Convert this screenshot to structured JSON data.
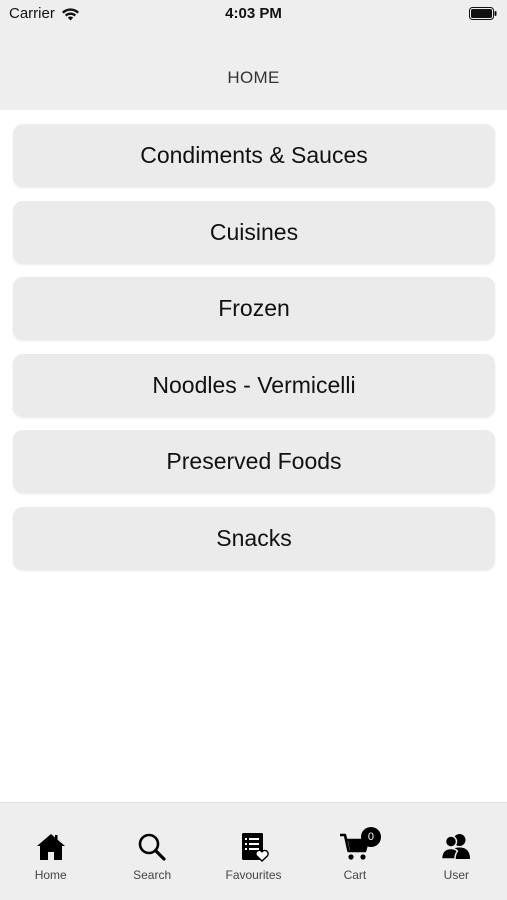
{
  "status_bar": {
    "carrier": "Carrier",
    "time": "4:03 PM",
    "icons": [
      "wifi-icon",
      "battery-icon"
    ]
  },
  "header": {
    "title": "HOME"
  },
  "categories": [
    {
      "label": "Condiments & Sauces"
    },
    {
      "label": "Cuisines"
    },
    {
      "label": "Frozen"
    },
    {
      "label": "Noodles - Vermicelli"
    },
    {
      "label": "Preserved Foods"
    },
    {
      "label": "Snacks"
    }
  ],
  "tab_bar": {
    "items": [
      {
        "label": "Home",
        "icon": "home-icon"
      },
      {
        "label": "Search",
        "icon": "search-icon"
      },
      {
        "label": "Favourites",
        "icon": "favourites-list-icon"
      },
      {
        "label": "Cart",
        "icon": "cart-icon",
        "badge": "0"
      },
      {
        "label": "User",
        "icon": "user-icon"
      }
    ]
  },
  "colors": {
    "bar_background": "#efeeef",
    "card_background": "#ecebec",
    "text": "#111111",
    "badge": "#000000"
  }
}
